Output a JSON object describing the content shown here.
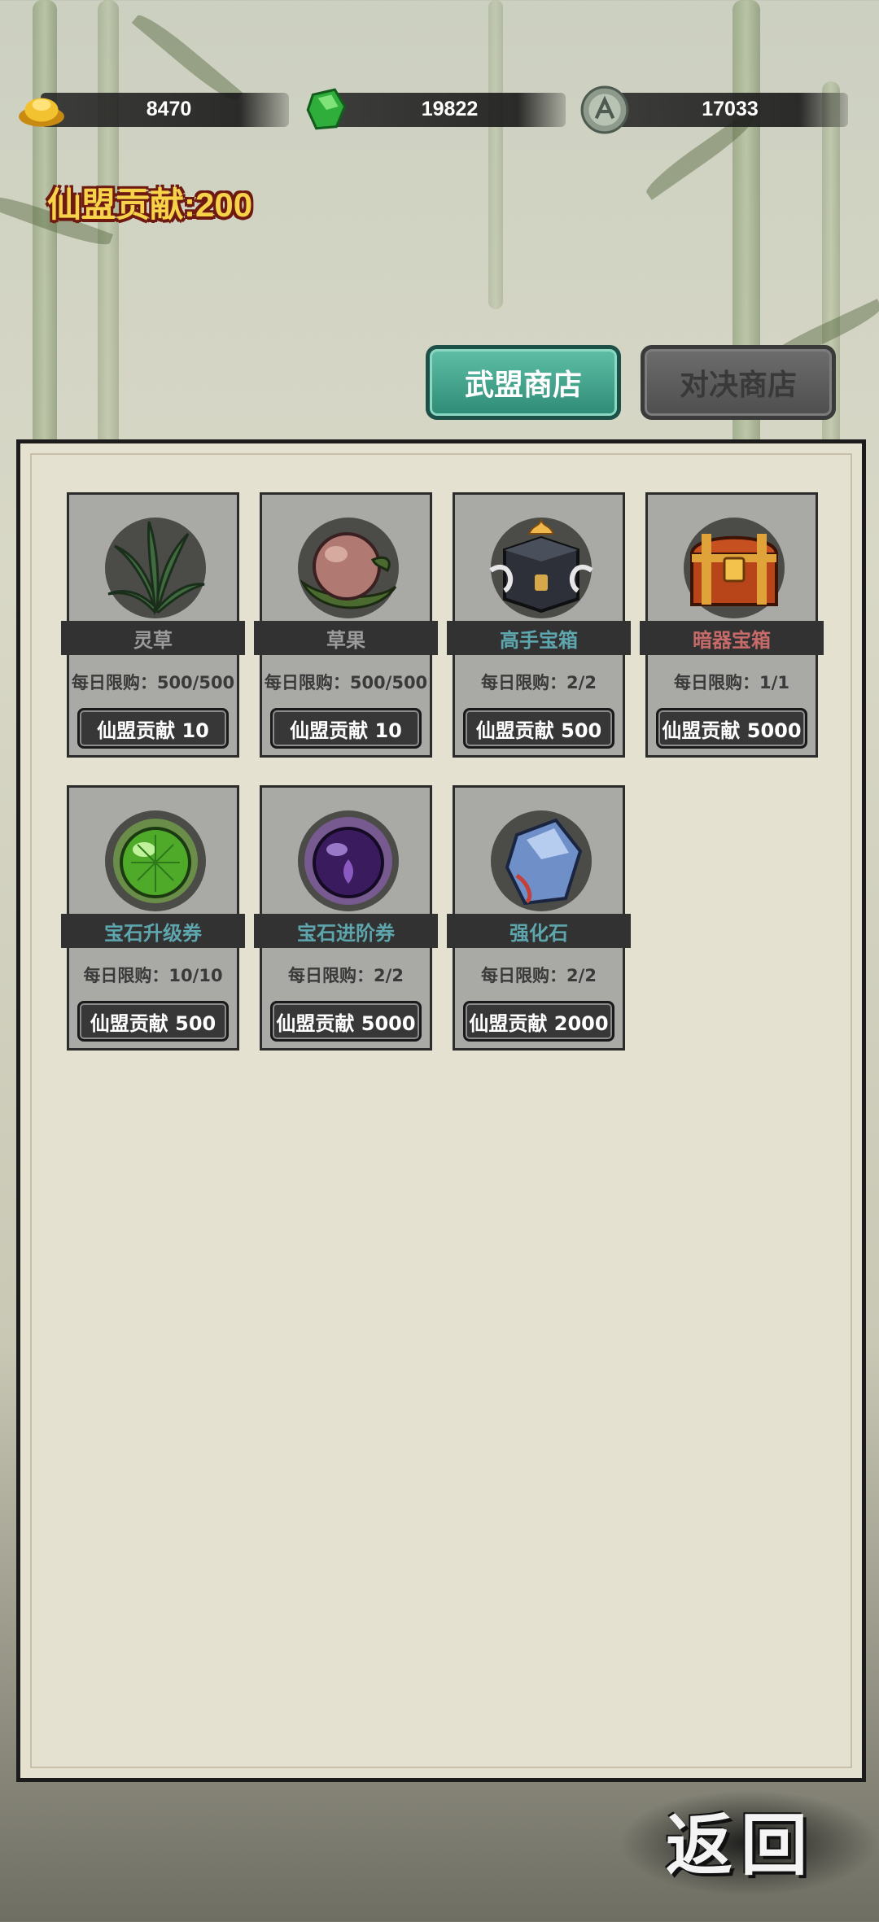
{
  "currencies": [
    {
      "icon": "gold-ingot-icon",
      "value": "8470"
    },
    {
      "icon": "jade-icon",
      "value": "19822"
    },
    {
      "icon": "silver-coin-icon",
      "value": "17033"
    }
  ],
  "contribution": "仙盟贡献:200",
  "tabs": [
    {
      "label": "武盟商店",
      "active": true
    },
    {
      "label": "对决商店",
      "active": false
    }
  ],
  "items": [
    {
      "name": "灵草",
      "name_color": "#9b9b9b",
      "limit": "每日限购：500/500",
      "price": "仙盟贡献 10",
      "icon": "herb-icon"
    },
    {
      "name": "草果",
      "name_color": "#9b9b9b",
      "limit": "每日限购：500/500",
      "price": "仙盟贡献 10",
      "icon": "fruit-icon"
    },
    {
      "name": "高手宝箱",
      "name_color": "#5ea6ad",
      "limit": "每日限购：2/2",
      "price": "仙盟贡献 500",
      "icon": "master-chest-icon"
    },
    {
      "name": "暗器宝箱",
      "name_color": "#c76a6a",
      "limit": "每日限购：1/1",
      "price": "仙盟贡献 5000",
      "icon": "treasure-chest-icon"
    },
    {
      "name": "宝石升级券",
      "name_color": "#5ea6ad",
      "limit": "每日限购：10/10",
      "price": "仙盟贡献 500",
      "icon": "green-gem-orb-icon"
    },
    {
      "name": "宝石进阶券",
      "name_color": "#5ea6ad",
      "limit": "每日限购：2/2",
      "price": "仙盟贡献 5000",
      "icon": "purple-gem-orb-icon"
    },
    {
      "name": "强化石",
      "name_color": "#5ea6ad",
      "limit": "每日限购：2/2",
      "price": "仙盟贡献 2000",
      "icon": "enhance-stone-icon"
    }
  ],
  "back_label": "返回"
}
